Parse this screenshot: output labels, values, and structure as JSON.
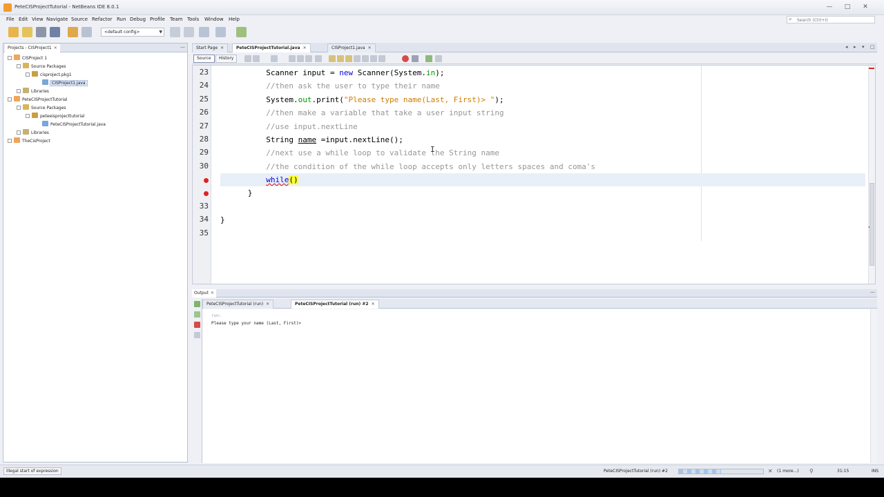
{
  "window": {
    "title": "PeteCISProjectTutorial - NetBeans IDE 8.0.1",
    "controls": [
      "—",
      "□",
      "✕"
    ]
  },
  "menu": [
    "File",
    "Edit",
    "View",
    "Navigate",
    "Source",
    "Refactor",
    "Run",
    "Debug",
    "Profile",
    "Team",
    "Tools",
    "Window",
    "Help"
  ],
  "search": {
    "placeholder": "Search (Ctrl+I)"
  },
  "toolbar": {
    "config": "<default config>"
  },
  "projects": {
    "tab_label": "Projects - CISProject1",
    "tree": [
      {
        "label": "CISProject 1",
        "icon": "project-icon"
      },
      {
        "label": "Source Packages",
        "icon": "package-folder-icon"
      },
      {
        "label": "cisproject.pkg1",
        "icon": "package-icon"
      },
      {
        "label": "CISProject1.java",
        "icon": "java-file-icon",
        "selected": true
      },
      {
        "label": "Libraries",
        "icon": "library-icon"
      },
      {
        "label": "PeteCISProjectTutorial",
        "icon": "project-icon"
      },
      {
        "label": "Source Packages",
        "icon": "package-folder-icon"
      },
      {
        "label": "peteeisprojecttutorial",
        "icon": "package-icon"
      },
      {
        "label": "PeteCISProjectTutorial.java",
        "icon": "java-file-icon"
      },
      {
        "label": "Libraries",
        "icon": "library-icon"
      },
      {
        "label": "TheCisProject",
        "icon": "project-icon"
      }
    ]
  },
  "editor": {
    "tabs": [
      {
        "label": "Start Page",
        "active": false
      },
      {
        "label": "PeteCISProjectTutorial.java",
        "active": true
      },
      {
        "label": "CISProject1.java",
        "active": false
      }
    ],
    "views": [
      "Source",
      "History"
    ],
    "line_numbers": [
      "23",
      "24",
      "25",
      "26",
      "27",
      "28",
      "29",
      "30",
      "",
      "",
      "33",
      "34",
      "35"
    ],
    "code": {
      "l23a": "Scanner input = ",
      "l23b": "new",
      "l23c": " Scanner(System.",
      "l23d": "in",
      "l23e": ");",
      "l24": "//then ask the user to type their name",
      "l25a": "System.",
      "l25b": "out",
      "l25c": ".print(",
      "l25d": "\"Please type name(Last, First)> \"",
      "l25e": ");",
      "l26": "//then make a variable that take a user input string",
      "l27": "//use input.nextLine",
      "l28a": "String ",
      "l28b": "name",
      "l28c": " =input.nextLine();",
      "l29": "//next use a while loop to validate the String name",
      "l30": "//the condition of the while loop accepts only letters spaces and coma's",
      "l31a": "while",
      "l31b": "()",
      "l32": "}",
      "l34": "}"
    }
  },
  "output": {
    "tab_label": "Output",
    "subtabs": [
      {
        "label": "PeteCISProjectTutorial (run)",
        "active": false
      },
      {
        "label": "PeteCISProjectTutorial (run) #2",
        "active": true
      }
    ],
    "lines": [
      "run:",
      "Please type your name (Last, First)>"
    ]
  },
  "status": {
    "message": "illegal start of expression",
    "run_label": "PeteCISProjectTutorial (run) #2",
    "progress": 0.5,
    "more": "(1 more...)",
    "position": "31:15",
    "mode": "INS"
  }
}
